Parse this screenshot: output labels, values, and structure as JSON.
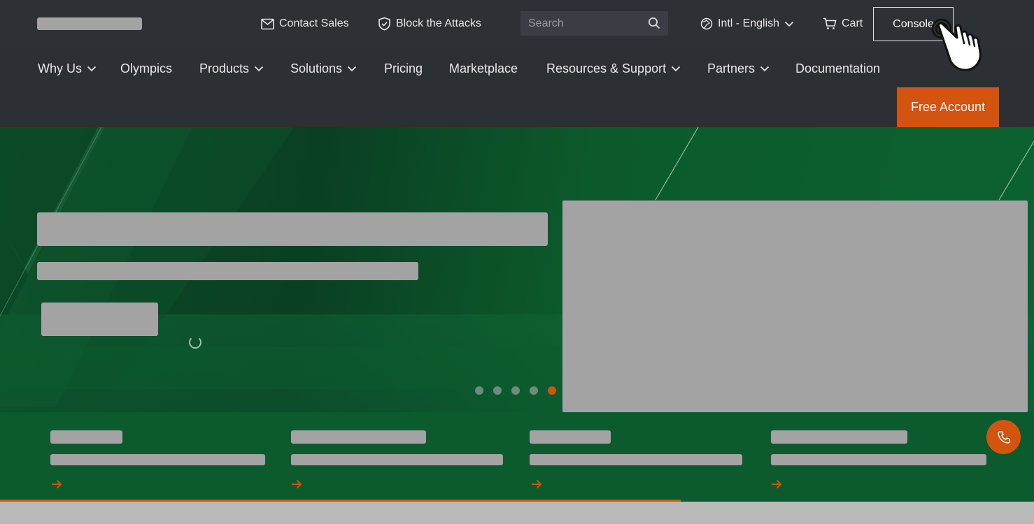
{
  "top": {
    "contact_sales": "Contact Sales",
    "block_attacks": "Block the Attacks",
    "search_placeholder": "Search",
    "language": "Intl - English",
    "cart": "Cart",
    "console": "Console"
  },
  "nav": {
    "items": [
      {
        "label": "Why Us",
        "dropdown": true
      },
      {
        "label": "Olympics",
        "dropdown": false
      },
      {
        "label": "Products",
        "dropdown": true
      },
      {
        "label": "Solutions",
        "dropdown": true
      },
      {
        "label": "Pricing",
        "dropdown": false
      },
      {
        "label": "Marketplace",
        "dropdown": false
      },
      {
        "label": "Resources & Support",
        "dropdown": true
      },
      {
        "label": "Partners",
        "dropdown": true
      },
      {
        "label": "Documentation",
        "dropdown": false
      }
    ],
    "free_account": "Free Account"
  },
  "carousel": {
    "slide_count": 5,
    "active_slide": 5
  },
  "colors": {
    "accent": "#d4530f",
    "topbar": "#2d3035",
    "hero_green": "#0b4a26",
    "placeholder": "#a3a3a3"
  },
  "icons": {
    "contact": "mail-icon",
    "block": "shield-check-icon",
    "search": "search-icon",
    "language": "globe-icon",
    "cart": "cart-icon",
    "phone": "phone-icon",
    "pointer": "hand-pointer-icon"
  }
}
